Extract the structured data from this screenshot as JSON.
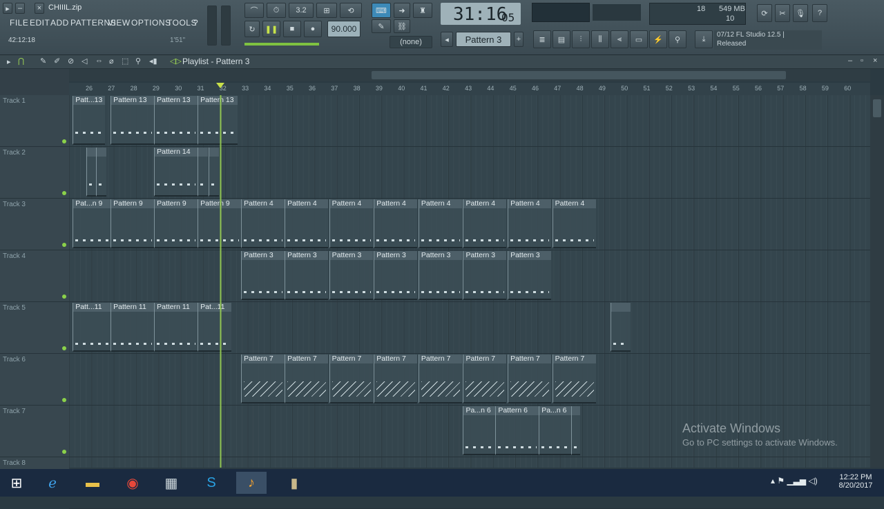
{
  "window": {
    "file_name": "CHIIIL.zip",
    "time_elapsed": "42:12:18",
    "time_small": "1'51\""
  },
  "menu": [
    "FILE",
    "EDIT",
    "ADD",
    "PATTERNS",
    "VIEW",
    "OPTIONS",
    "TOOLS",
    "?"
  ],
  "transport": {
    "tempo": "90.000",
    "song_time": "31:16",
    "song_time_ticks": "05",
    "snap": "(none)",
    "pattern_selector": "Pattern 3",
    "time_sig_value": "3.2",
    "memory": "549 MB",
    "cpu": "18",
    "poly": "10"
  },
  "news": {
    "line1": "07/12  FL Studio 12.5 |",
    "line2": "Released"
  },
  "playlist": {
    "title": "Playlist - Pattern 3"
  },
  "ruler": [
    "26",
    "27",
    "28",
    "29",
    "30",
    "31",
    "32",
    "33",
    "34",
    "35",
    "36",
    "37",
    "38",
    "39",
    "40",
    "41",
    "42",
    "43",
    "44",
    "45",
    "46",
    "47",
    "48",
    "49",
    "50",
    "51",
    "52",
    "53",
    "54",
    "55",
    "56",
    "57",
    "58",
    "59",
    "60"
  ],
  "tracks": [
    "Track 1",
    "Track 2",
    "Track 3",
    "Track 4",
    "Track 5",
    "Track 6",
    "Track 7",
    "Track 8"
  ],
  "clips": [
    {
      "track": 0,
      "label": "Patt...13",
      "bar": 26.1,
      "len": 1.45
    },
    {
      "track": 0,
      "label": "Pattern 13",
      "bar": 27.8,
      "len": 1.95
    },
    {
      "track": 0,
      "label": "Pattern 13",
      "bar": 29.75,
      "len": 1.95
    },
    {
      "track": 0,
      "label": "Pattern 13",
      "bar": 31.7,
      "len": 1.8
    },
    {
      "track": 1,
      "label": "",
      "bar": 26.7,
      "len": 0.45
    },
    {
      "track": 1,
      "label": "",
      "bar": 27.15,
      "len": 0.45
    },
    {
      "track": 1,
      "label": "Pattern 14",
      "bar": 29.75,
      "len": 1.95
    },
    {
      "track": 1,
      "label": "",
      "bar": 31.7,
      "len": 0.45
    },
    {
      "track": 1,
      "label": "",
      "bar": 32.2,
      "len": 0.45
    },
    {
      "track": 2,
      "label": "Pat...n 9",
      "bar": 26.1,
      "len": 1.7
    },
    {
      "track": 2,
      "label": "Pattern 9",
      "bar": 27.8,
      "len": 1.95
    },
    {
      "track": 2,
      "label": "Pattern 9",
      "bar": 29.75,
      "len": 1.95
    },
    {
      "track": 2,
      "label": "Pattern 9",
      "bar": 31.7,
      "len": 1.95
    },
    {
      "track": 2,
      "label": "Pattern 4",
      "bar": 33.65,
      "len": 1.95
    },
    {
      "track": 2,
      "label": "Pattern 4",
      "bar": 35.6,
      "len": 1.95
    },
    {
      "track": 2,
      "label": "Pattern 4",
      "bar": 37.6,
      "len": 1.95
    },
    {
      "track": 2,
      "label": "Pattern 4",
      "bar": 39.6,
      "len": 1.95
    },
    {
      "track": 2,
      "label": "Pattern 4",
      "bar": 41.6,
      "len": 1.95
    },
    {
      "track": 2,
      "label": "Pattern 4",
      "bar": 43.6,
      "len": 1.95
    },
    {
      "track": 2,
      "label": "Pattern 4",
      "bar": 45.6,
      "len": 1.95
    },
    {
      "track": 2,
      "label": "Pattern 4",
      "bar": 47.6,
      "len": 1.95
    },
    {
      "track": 3,
      "label": "Pattern 3",
      "bar": 33.65,
      "len": 1.95
    },
    {
      "track": 3,
      "label": "Pattern 3",
      "bar": 35.6,
      "len": 1.95
    },
    {
      "track": 3,
      "label": "Pattern 3",
      "bar": 37.6,
      "len": 1.95
    },
    {
      "track": 3,
      "label": "Pattern 3",
      "bar": 39.6,
      "len": 1.95
    },
    {
      "track": 3,
      "label": "Pattern 3",
      "bar": 41.6,
      "len": 1.95
    },
    {
      "track": 3,
      "label": "Pattern 3",
      "bar": 43.6,
      "len": 1.95
    },
    {
      "track": 3,
      "label": "Pattern 3",
      "bar": 45.6,
      "len": 1.95
    },
    {
      "track": 4,
      "label": "Patt...11",
      "bar": 26.1,
      "len": 1.7
    },
    {
      "track": 4,
      "label": "Pattern 11",
      "bar": 27.8,
      "len": 1.95
    },
    {
      "track": 4,
      "label": "Pattern 11",
      "bar": 29.75,
      "len": 1.95
    },
    {
      "track": 4,
      "label": "Pat...11",
      "bar": 31.7,
      "len": 1.5
    },
    {
      "track": 4,
      "label": "",
      "bar": 50.2,
      "len": 0.9
    },
    {
      "track": 5,
      "label": "Pattern 7",
      "bar": 33.65,
      "len": 1.95
    },
    {
      "track": 5,
      "label": "Pattern 7",
      "bar": 35.6,
      "len": 1.95
    },
    {
      "track": 5,
      "label": "Pattern 7",
      "bar": 37.6,
      "len": 1.95
    },
    {
      "track": 5,
      "label": "Pattern 7",
      "bar": 39.6,
      "len": 1.95
    },
    {
      "track": 5,
      "label": "Pattern 7",
      "bar": 41.6,
      "len": 1.95
    },
    {
      "track": 5,
      "label": "Pattern 7",
      "bar": 43.6,
      "len": 1.95
    },
    {
      "track": 5,
      "label": "Pattern 7",
      "bar": 45.6,
      "len": 1.95
    },
    {
      "track": 5,
      "label": "Pattern 7",
      "bar": 47.6,
      "len": 1.95
    },
    {
      "track": 6,
      "label": "Pa...n 6",
      "bar": 43.6,
      "len": 1.45
    },
    {
      "track": 6,
      "label": "Pattern 6",
      "bar": 45.05,
      "len": 1.95
    },
    {
      "track": 6,
      "label": "Pa...n 6",
      "bar": 47.0,
      "len": 1.45
    },
    {
      "track": 6,
      "label": "",
      "bar": 48.45,
      "len": 0.4
    }
  ],
  "watermark": {
    "line1": "Activate Windows",
    "line2": "Go to PC settings to activate Windows."
  },
  "taskbar": {
    "time": "12:22 PM",
    "date": "8/20/2017"
  },
  "colors": {
    "accent": "#9ed655",
    "background": "#2b3a42"
  }
}
